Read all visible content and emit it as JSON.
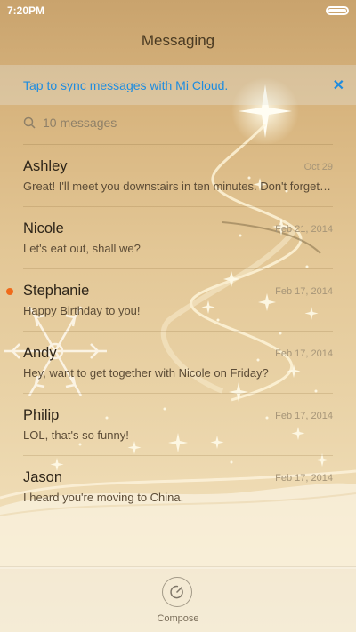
{
  "status_bar": {
    "time": "7:20PM"
  },
  "header": {
    "title": "Messaging"
  },
  "sync_banner": {
    "text": "Tap to sync messages with Mi Cloud.",
    "close_icon": "close-icon"
  },
  "search": {
    "placeholder": "10 messages",
    "icon": "search-icon"
  },
  "conversations": [
    {
      "name": "Ashley",
      "date": "Oct 29",
      "preview": "Great! I'll meet you downstairs in ten minutes. Don't forget the tickets!",
      "unread": false
    },
    {
      "name": "Nicole",
      "date": "Feb 21, 2014",
      "preview": "Let's eat out, shall we?",
      "unread": false
    },
    {
      "name": "Stephanie",
      "date": "Feb 17, 2014",
      "preview": "Happy Birthday to you!",
      "unread": true
    },
    {
      "name": "Andy",
      "date": "Feb 17, 2014",
      "preview": "Hey, want to get together with Nicole on Friday?",
      "unread": false
    },
    {
      "name": "Philip",
      "date": "Feb 17, 2014",
      "preview": "LOL, that's so funny!",
      "unread": false
    },
    {
      "name": "Jason",
      "date": "Feb 17, 2014",
      "preview": "I heard you're moving to China.",
      "unread": false
    }
  ],
  "bottom_bar": {
    "compose_label": "Compose",
    "compose_icon": "compose-icon"
  },
  "colors": {
    "accent": "#1e8ce0",
    "unread": "#f06a1a"
  }
}
